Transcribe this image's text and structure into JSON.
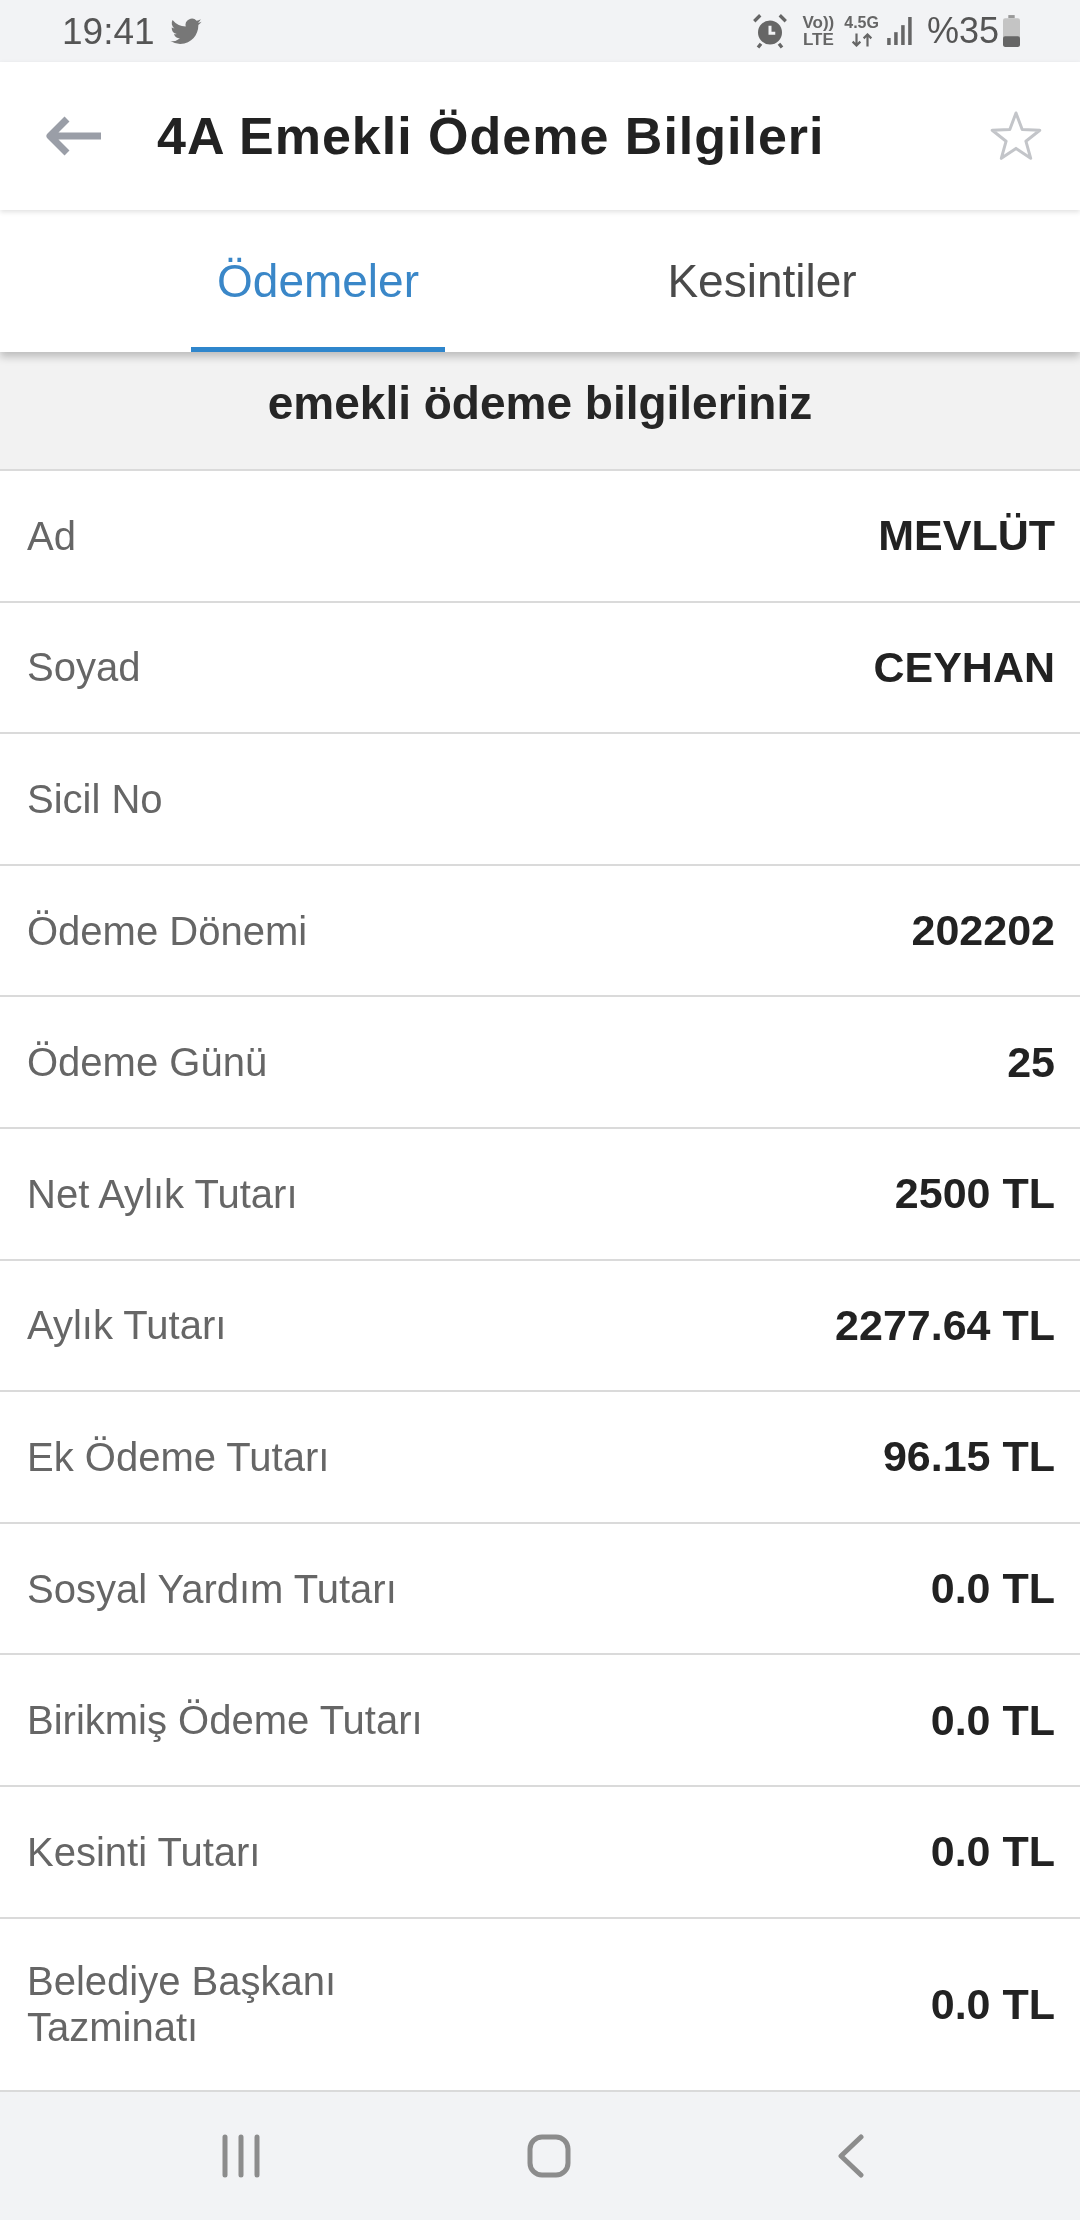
{
  "status_bar": {
    "time": "19:41",
    "volte": "Vo))",
    "lte": "LTE",
    "network": "4.5G",
    "battery": "%35"
  },
  "app_bar": {
    "title": "4A Emekli Ödeme Bilgileri",
    "favorite": false
  },
  "tabs": [
    {
      "label": "Ödemeler",
      "selected": true
    },
    {
      "label": "Kesintiler",
      "selected": false
    }
  ],
  "heading": "emekli ödeme bilgileriniz",
  "rows": [
    {
      "label": "Ad",
      "value": "MEVLÜT"
    },
    {
      "label": "Soyad",
      "value": "CEYHAN"
    },
    {
      "label": "Sicil No"
    },
    {
      "label": "Ödeme Dönemi",
      "value": "202202"
    },
    {
      "label": "Ödeme Günü",
      "value": "25"
    },
    {
      "label": "Net Aylık Tutarı",
      "value": "2500 TL"
    },
    {
      "label": "Aylık Tutarı",
      "value": "2277.64 TL"
    },
    {
      "label": "Ek Ödeme Tutarı",
      "value": "96.15 TL"
    },
    {
      "label": "Sosyal Yardım Tutarı",
      "value": "0.0 TL"
    },
    {
      "label": "Birikmiş Ödeme Tutarı",
      "value": "0.0 TL"
    },
    {
      "label": "Kesinti Tutarı",
      "value": "0.0 TL"
    },
    {
      "label": "Belediye Başkanı Tazminatı",
      "value": "0.0 TL"
    }
  ]
}
